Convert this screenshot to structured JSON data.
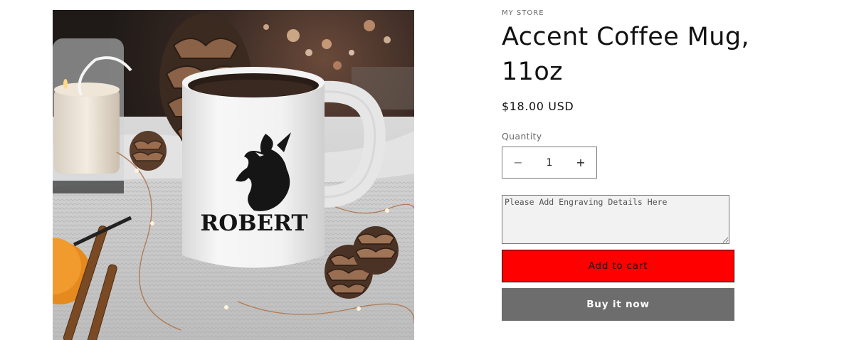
{
  "product": {
    "vendor": "MY STORE",
    "title": "Accent Coffee Mug, 11oz",
    "price": "$18.00 USD",
    "image_name": "mug-with-dragon-robert",
    "mug_print_text": "ROBERT"
  },
  "quantity": {
    "label": "Quantity",
    "value": "1",
    "minus_symbol": "−",
    "plus_symbol": "+"
  },
  "engraving": {
    "placeholder": "Please Add Engraving Details Here"
  },
  "buttons": {
    "add_to_cart": "Add to cart",
    "buy_now": "Buy it now"
  },
  "colors": {
    "add_to_cart_bg": "#ff0000",
    "buy_now_bg": "#6d6d6d"
  }
}
